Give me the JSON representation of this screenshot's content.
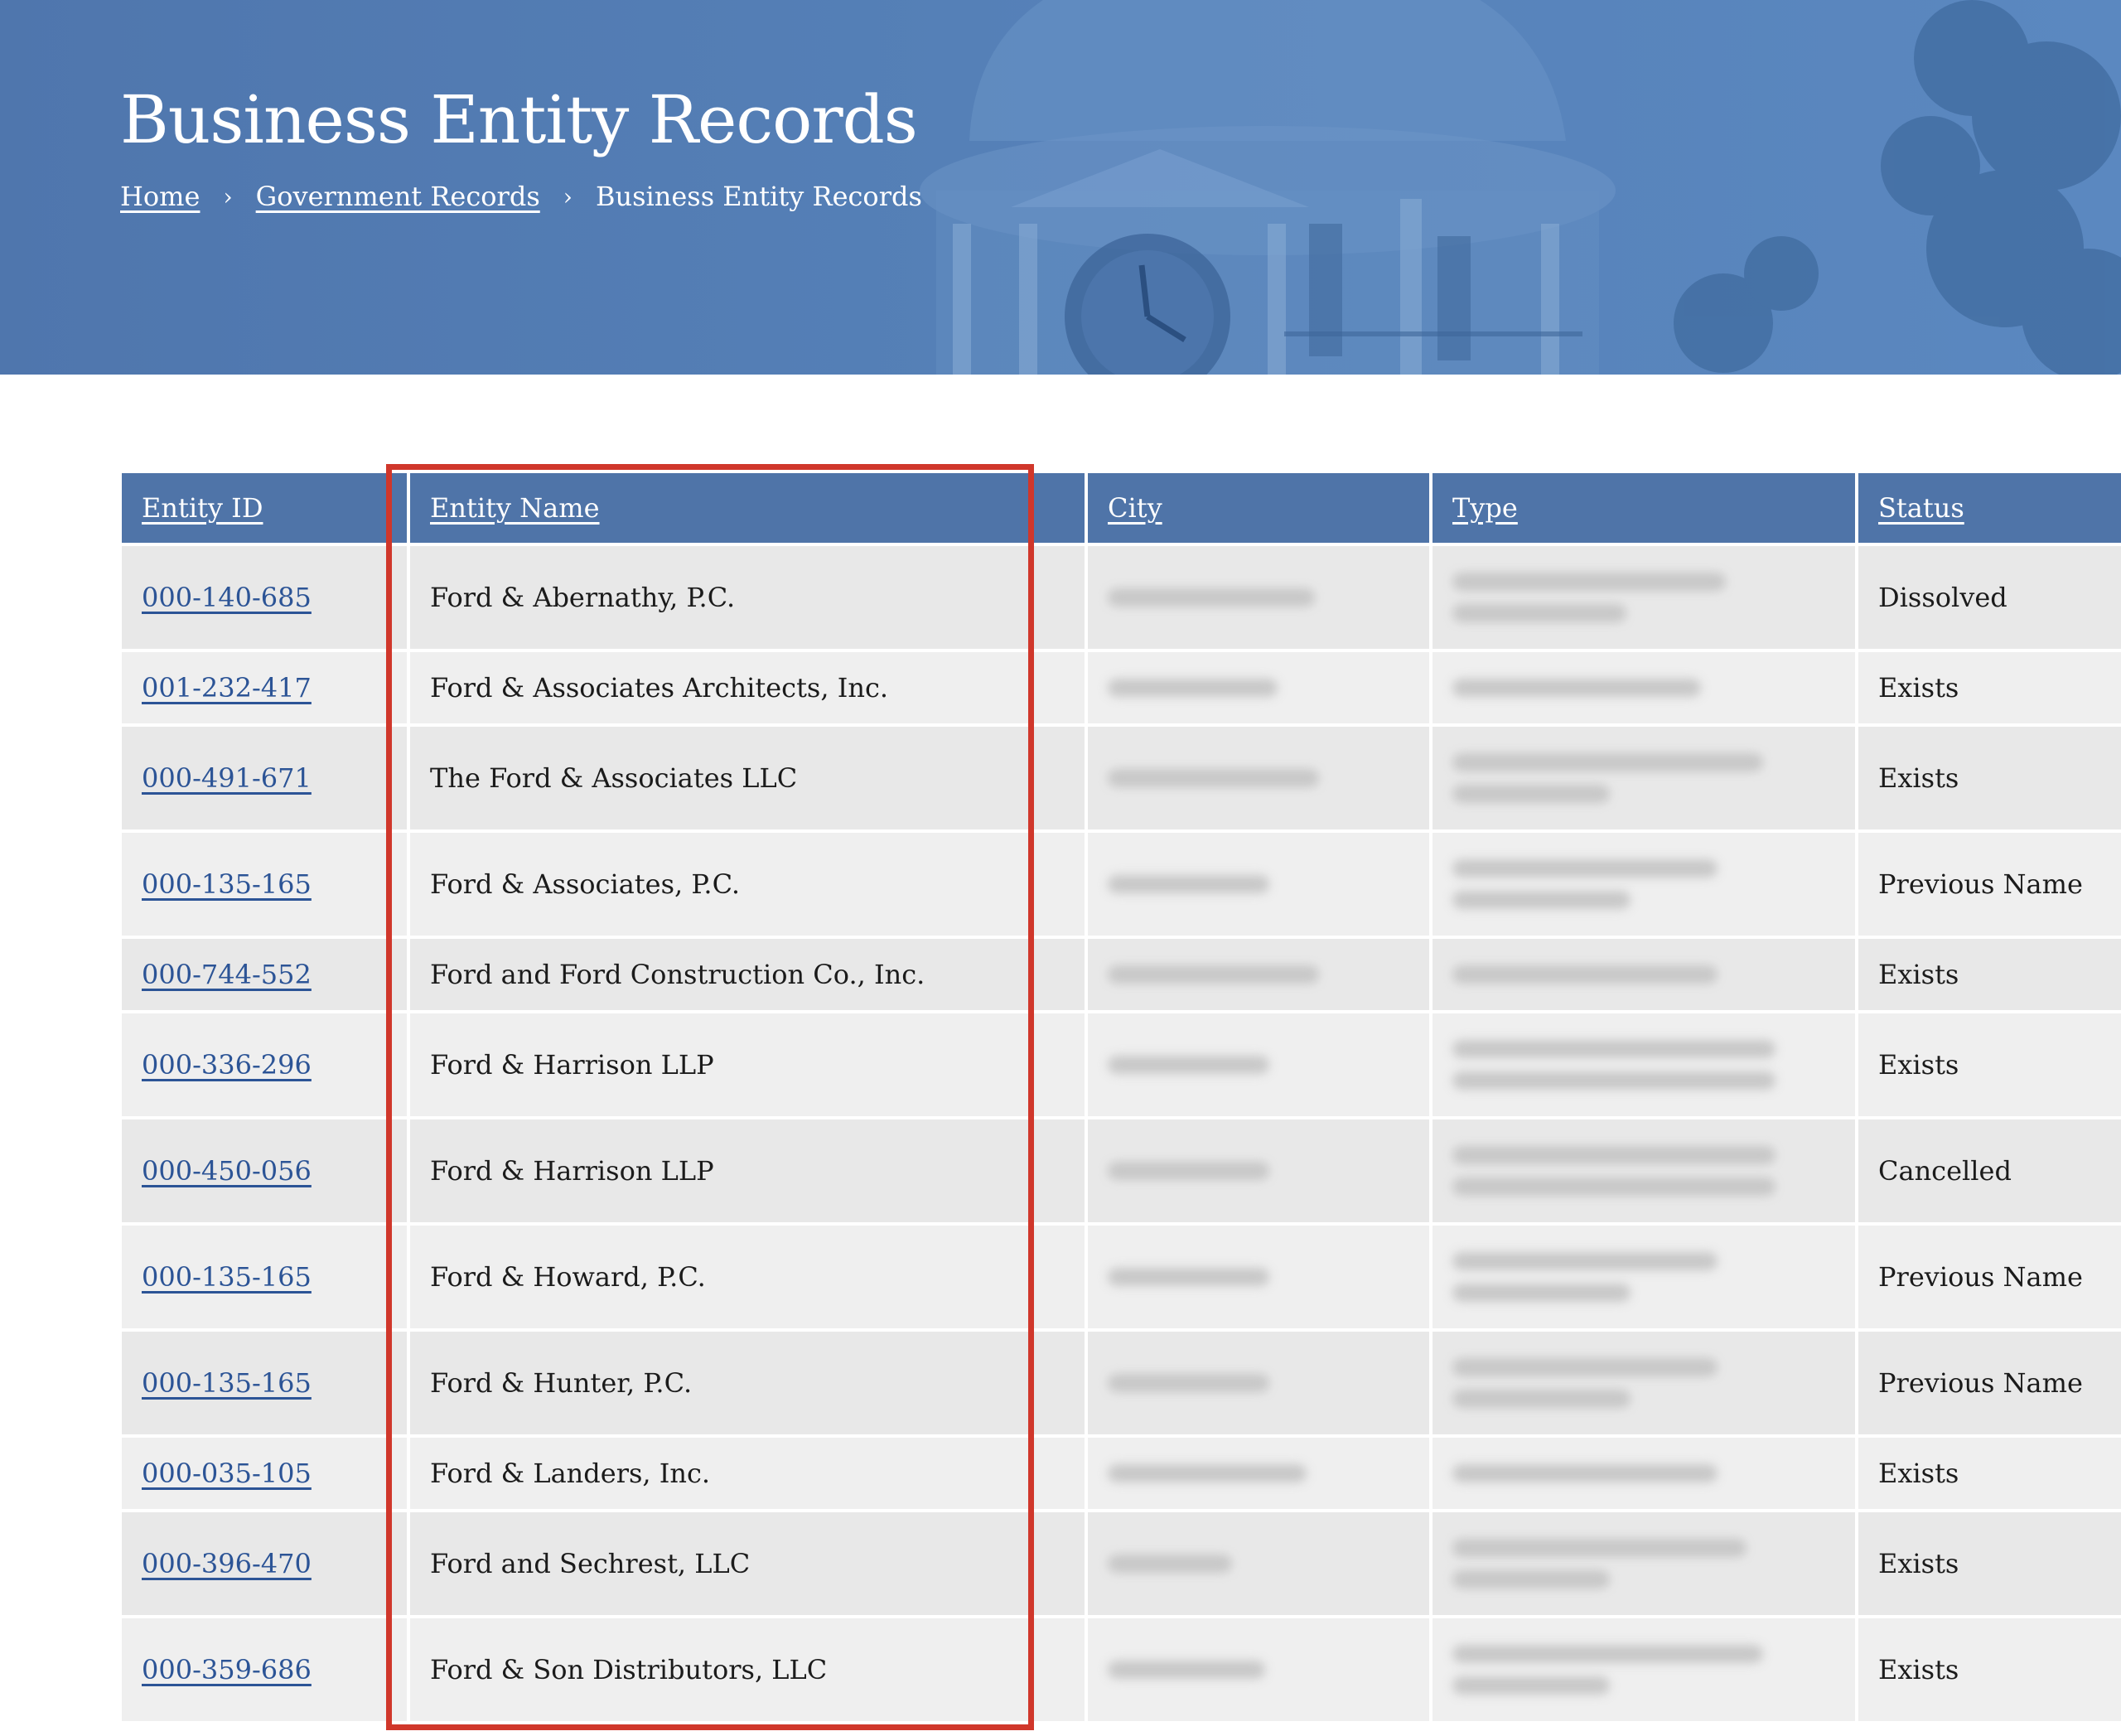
{
  "header": {
    "title": "Business Entity Records",
    "breadcrumb": [
      "Home",
      "Government Records",
      "Business Entity Records"
    ]
  },
  "table": {
    "columns": [
      "Entity ID",
      "Entity Name",
      "City",
      "Type",
      "Status"
    ],
    "rows": [
      {
        "id": "000-140-685",
        "name": "Ford & Abernathy, P.C.",
        "status": "Dissolved"
      },
      {
        "id": "001-232-417",
        "name": "Ford & Associates Architects, Inc.",
        "status": "Exists"
      },
      {
        "id": "000-491-671",
        "name": "The Ford & Associates LLC",
        "status": "Exists"
      },
      {
        "id": "000-135-165",
        "name": "Ford & Associates, P.C.",
        "status": "Previous Name"
      },
      {
        "id": "000-744-552",
        "name": "Ford and Ford Construction Co., Inc.",
        "status": "Exists"
      },
      {
        "id": "000-336-296",
        "name": "Ford & Harrison LLP",
        "status": "Exists"
      },
      {
        "id": "000-450-056",
        "name": "Ford & Harrison LLP",
        "status": "Cancelled"
      },
      {
        "id": "000-135-165",
        "name": "Ford & Howard, P.C.",
        "status": "Previous Name"
      },
      {
        "id": "000-135-165",
        "name": "Ford & Hunter, P.C.",
        "status": "Previous Name"
      },
      {
        "id": "000-035-105",
        "name": "Ford & Landers, Inc.",
        "status": "Exists"
      },
      {
        "id": "000-396-470",
        "name": "Ford and Sechrest, LLC",
        "status": "Exists"
      },
      {
        "id": "000-359-686",
        "name": "Ford & Son Distributors, LLC",
        "status": "Exists"
      }
    ]
  },
  "colors": {
    "hero": "#5580b7",
    "table_header": "#4f74a8",
    "link": "#2c5496",
    "highlight": "#d0372b"
  }
}
